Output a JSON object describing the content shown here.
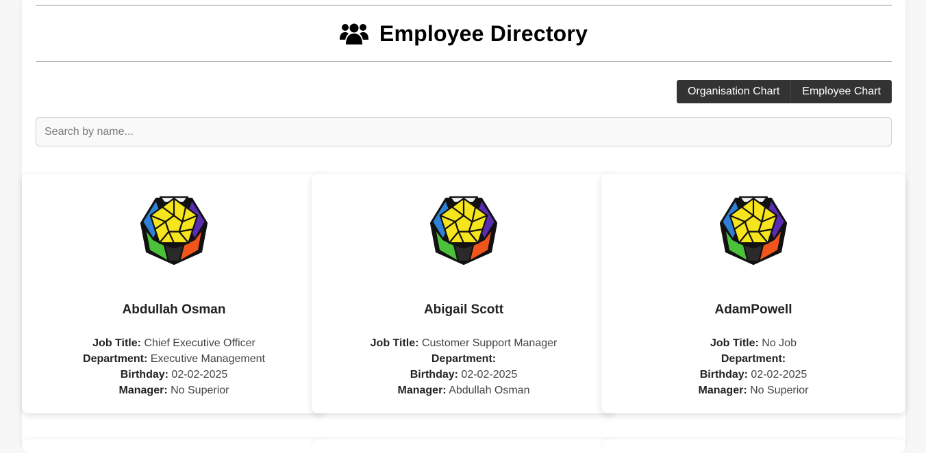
{
  "header": {
    "title": "Employee Directory",
    "icon": "users-icon"
  },
  "toolbar": {
    "org_chart_label": "Organisation Chart",
    "employee_chart_label": "Employee Chart"
  },
  "search": {
    "placeholder": "Search by name...",
    "value": ""
  },
  "labels": {
    "job_title": "Job Title:",
    "department": "Department:",
    "birthday": "Birthday:",
    "manager": "Manager:"
  },
  "employees": [
    {
      "name": "Abdullah Osman",
      "job_title": "Chief Executive Officer",
      "department": "Executive Management",
      "birthday": "02-02-2025",
      "manager": "No Superior",
      "avatar": "megaminx-avatar"
    },
    {
      "name": "Abigail Scott",
      "job_title": "Customer Support Manager",
      "department": "",
      "birthday": "02-02-2025",
      "manager": "Abdullah Osman",
      "avatar": "megaminx-avatar"
    },
    {
      "name": "AdamPowell",
      "job_title": "No Job",
      "department": "",
      "birthday": "02-02-2025",
      "manager": "No Superior",
      "avatar": "megaminx-avatar"
    }
  ],
  "colors": {
    "button_bg": "#333333",
    "rule": "#8f8f8f",
    "cube_yellow": "#f6e51c",
    "cube_green": "#4cc23a",
    "cube_orange": "#f0561c",
    "cube_blue": "#2e7fd6",
    "cube_purple": "#5a2db0"
  }
}
